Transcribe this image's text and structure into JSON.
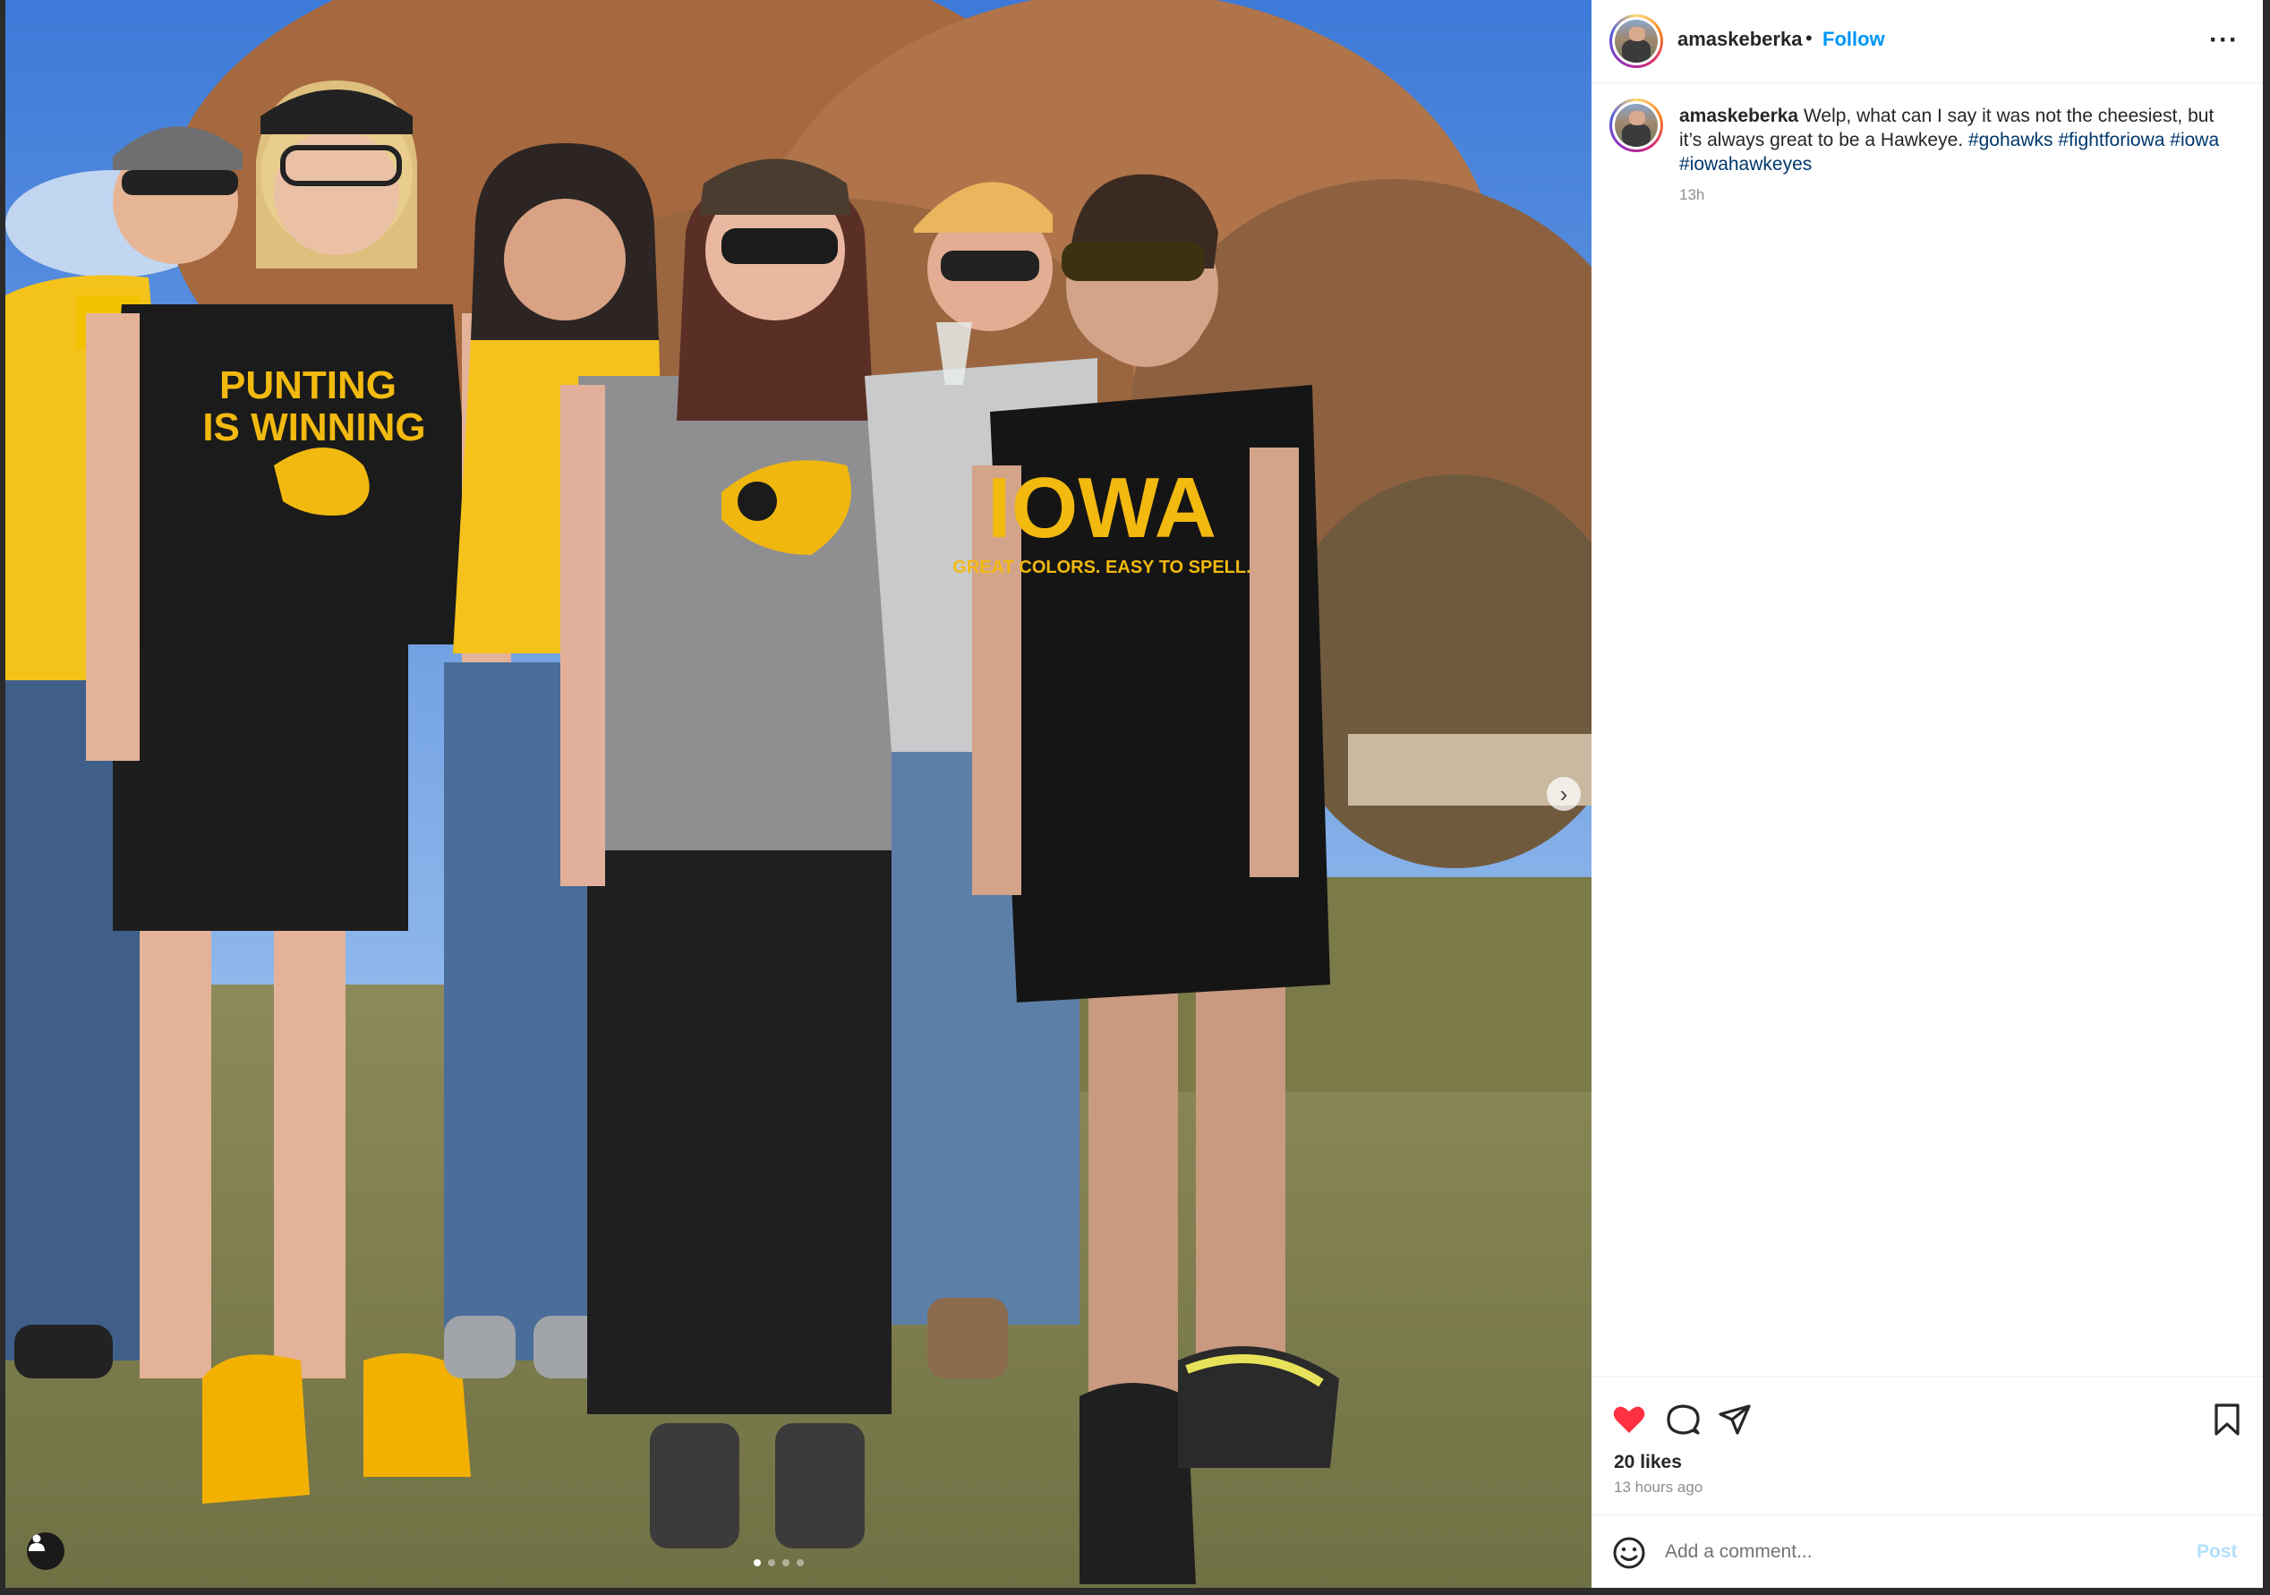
{
  "post": {
    "username": "amaskeberka",
    "separator": "•",
    "follow_label": "Follow",
    "more_label": "···",
    "caption_user": "amaskeberka",
    "caption_text": " Welp, what can I say it was not the cheesiest, but it’s always great to be a Hawkeye. ",
    "hashtags": [
      "#gohawks",
      "#fightforiowa",
      "#iowa",
      "#iowahawkeyes"
    ],
    "caption_time": "13h",
    "likes_label": "20 likes",
    "age_label": "13 hours ago",
    "liked": true,
    "carousel_index": 1,
    "carousel_count": 4
  },
  "photo": {
    "shirt_texts": [
      "PUNTING",
      "IS WINNING",
      "IOWA",
      "GREAT COLORS. EASY TO SPELL."
    ]
  },
  "comment": {
    "placeholder": "Add a comment...",
    "post_label": "Post"
  },
  "icons": {
    "like": "heart-icon",
    "comment": "comment-icon",
    "share": "share-icon",
    "save": "bookmark-icon",
    "emoji": "emoji-icon",
    "next": "chevron-right-icon",
    "tag": "user-tag-icon"
  },
  "colors": {
    "accent": "#0095f6",
    "like": "#ff3040",
    "hashtag": "#00376b",
    "post_disabled": "#b3dffc",
    "hawkeye_gold": "#f5b400"
  }
}
